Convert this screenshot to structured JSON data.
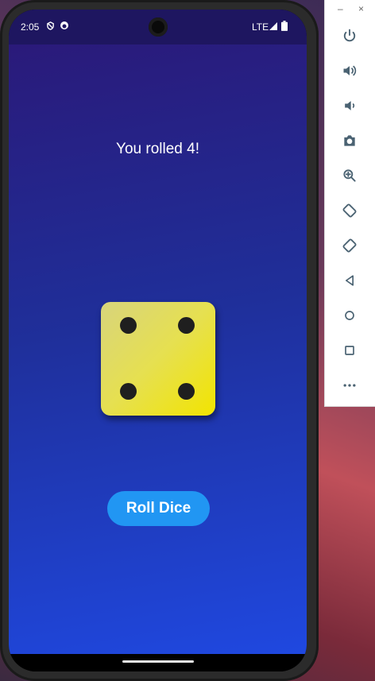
{
  "status_bar": {
    "time": "2:05",
    "network": "LTE",
    "icons": [
      "shield-icon",
      "notification-badge-icon",
      "signal-icon",
      "battery-icon"
    ]
  },
  "app": {
    "result_text": "You rolled 4!",
    "dice_value": 4,
    "roll_button_label": "Roll Dice",
    "colors": {
      "background_top": "#2a1a7a",
      "background_bottom": "#1f48e0",
      "dice_face": "#e6e050",
      "pip": "#1f1f1f",
      "button": "#2196f3"
    }
  },
  "emulator_toolbar": {
    "minimize_label": "–",
    "close_label": "×",
    "buttons": [
      {
        "name": "power-icon"
      },
      {
        "name": "volume-up-icon"
      },
      {
        "name": "volume-down-icon"
      },
      {
        "name": "camera-icon"
      },
      {
        "name": "zoom-icon"
      },
      {
        "name": "rotate-left-icon"
      },
      {
        "name": "rotate-right-icon"
      },
      {
        "name": "back-icon"
      },
      {
        "name": "home-icon"
      },
      {
        "name": "overview-icon"
      },
      {
        "name": "more-icon"
      }
    ]
  }
}
